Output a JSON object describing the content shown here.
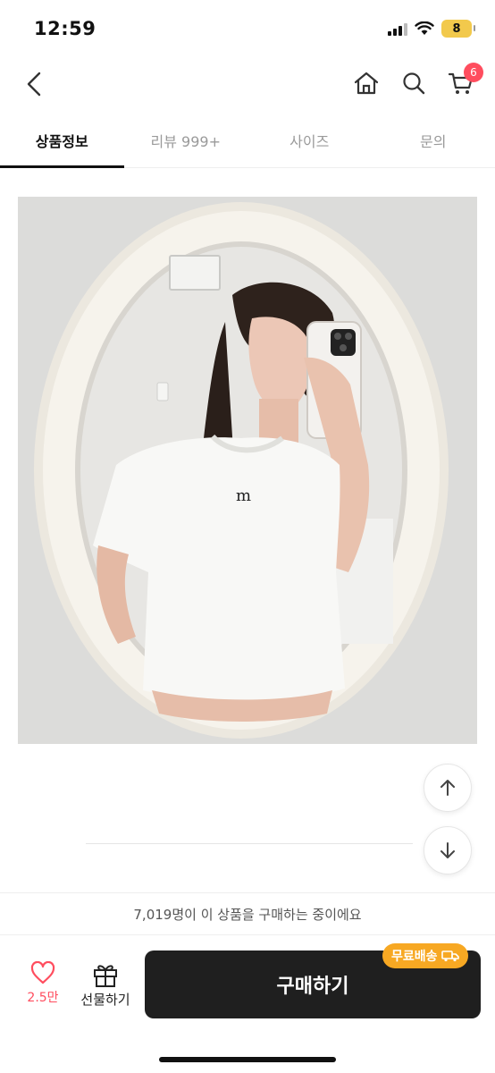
{
  "status_bar": {
    "time": "12:59",
    "battery": "8"
  },
  "header": {
    "cart_count": "6"
  },
  "tabs": [
    {
      "label": "상품정보",
      "active": true
    },
    {
      "label": "리뷰 999+",
      "active": false
    },
    {
      "label": "사이즈",
      "active": false
    },
    {
      "label": "문의",
      "active": false
    }
  ],
  "notice": {
    "text": "7,019명이 이 상품을 구매하는 중이에요"
  },
  "bottom_bar": {
    "like_count": "2.5만",
    "gift_label": "선물하기",
    "buy_label": "구매하기",
    "shipping_badge": "무료배송"
  },
  "colors": {
    "accent": "#ff4d5e",
    "buy_button": "#1f1f1f",
    "shipping_badge": "#f7a823"
  }
}
